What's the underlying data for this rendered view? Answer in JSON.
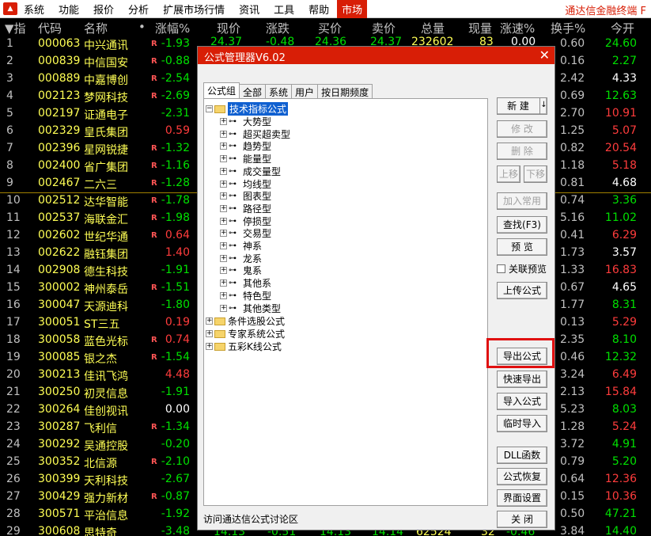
{
  "menubar": {
    "items": [
      "系统",
      "功能",
      "报价",
      "分析",
      "扩展市场行情",
      "资讯",
      "工具",
      "帮助"
    ],
    "active_tab": "市场",
    "right_title": "通达信金融终端 F"
  },
  "columns": {
    "idx": "▼指",
    "code": "代码",
    "name": "名称",
    "dot": "•",
    "chg_pct": "涨幅%",
    "price": "现价",
    "change": "涨跌",
    "bid": "买价",
    "ask": "卖价",
    "volume": "总量",
    "cur_vol": "现量",
    "speed": "涨速%",
    "turnover": "换手%",
    "open": "今开"
  },
  "rows": [
    {
      "idx": "1",
      "code": "000063",
      "name": "中兴通讯",
      "flag": "R",
      "chg": "-1.93",
      "turn": "0.60",
      "open": "24.60",
      "chg_c": "dn",
      "open_c": "dn"
    },
    {
      "idx": "2",
      "code": "000839",
      "name": "中信国安",
      "flag": "R",
      "chg": "-0.88",
      "turn": "0.16",
      "open": "2.27",
      "chg_c": "dn",
      "open_c": "dn"
    },
    {
      "idx": "3",
      "code": "000889",
      "name": "中嘉博创",
      "flag": "R",
      "chg": "-2.54",
      "turn": "2.42",
      "open": "4.33",
      "chg_c": "dn",
      "open_c": "flat"
    },
    {
      "idx": "4",
      "code": "002123",
      "name": "梦网科技",
      "flag": "R",
      "chg": "-2.69",
      "turn": "0.69",
      "open": "12.63",
      "chg_c": "dn",
      "open_c": "dn"
    },
    {
      "idx": "5",
      "code": "002197",
      "name": "证通电子",
      "flag": "",
      "chg": "-2.31",
      "turn": "2.70",
      "open": "10.91",
      "chg_c": "dn",
      "open_c": "up"
    },
    {
      "idx": "6",
      "code": "002329",
      "name": "皇氏集团",
      "flag": "",
      "chg": "0.59",
      "turn": "1.25",
      "open": "5.07",
      "chg_c": "up",
      "open_c": "up"
    },
    {
      "idx": "7",
      "code": "002396",
      "name": "星网锐捷",
      "flag": "R",
      "chg": "-1.32",
      "turn": "0.82",
      "open": "20.54",
      "chg_c": "dn",
      "open_c": "up"
    },
    {
      "idx": "8",
      "code": "002400",
      "name": "省广集团",
      "flag": "R",
      "chg": "-1.16",
      "turn": "1.18",
      "open": "5.18",
      "chg_c": "dn",
      "open_c": "up"
    },
    {
      "idx": "9",
      "code": "002467",
      "name": "二六三",
      "flag": "R",
      "chg": "-1.28",
      "turn": "0.81",
      "open": "4.68",
      "chg_c": "dn",
      "open_c": "flat"
    },
    {
      "idx": "10",
      "code": "002512",
      "name": "达华智能",
      "flag": "R",
      "chg": "-1.78",
      "turn": "0.74",
      "open": "3.36",
      "chg_c": "dn",
      "open_c": "dn"
    },
    {
      "idx": "11",
      "code": "002537",
      "name": "海联金汇",
      "flag": "R",
      "chg": "-1.98",
      "turn": "5.16",
      "open": "11.02",
      "chg_c": "dn",
      "open_c": "dn"
    },
    {
      "idx": "12",
      "code": "002602",
      "name": "世纪华通",
      "flag": "R",
      "chg": "0.64",
      "turn": "0.41",
      "open": "6.29",
      "chg_c": "up",
      "open_c": "up"
    },
    {
      "idx": "13",
      "code": "002622",
      "name": "融钰集团",
      "flag": "",
      "chg": "1.40",
      "turn": "1.73",
      "open": "3.57",
      "chg_c": "up",
      "open_c": "flat"
    },
    {
      "idx": "14",
      "code": "002908",
      "name": "德生科技",
      "flag": "",
      "chg": "-1.91",
      "turn": "1.33",
      "open": "16.83",
      "chg_c": "dn",
      "open_c": "up"
    },
    {
      "idx": "15",
      "code": "300002",
      "name": "神州泰岳",
      "flag": "R",
      "chg": "-1.51",
      "turn": "0.67",
      "open": "4.65",
      "chg_c": "dn",
      "open_c": "flat"
    },
    {
      "idx": "16",
      "code": "300047",
      "name": "天源迪科",
      "flag": "",
      "chg": "-1.80",
      "turn": "1.77",
      "open": "8.31",
      "chg_c": "dn",
      "open_c": "dn"
    },
    {
      "idx": "17",
      "code": "300051",
      "name": "ST三五",
      "flag": "",
      "chg": "0.19",
      "turn": "0.13",
      "open": "5.29",
      "chg_c": "up",
      "open_c": "up"
    },
    {
      "idx": "18",
      "code": "300058",
      "name": "蓝色光标",
      "flag": "R",
      "chg": "0.74",
      "turn": "2.35",
      "open": "8.10",
      "chg_c": "up",
      "open_c": "dn"
    },
    {
      "idx": "19",
      "code": "300085",
      "name": "银之杰",
      "flag": "R",
      "chg": "-1.54",
      "turn": "0.46",
      "open": "12.32",
      "chg_c": "dn",
      "open_c": "dn"
    },
    {
      "idx": "20",
      "code": "300213",
      "name": "佳讯飞鸿",
      "flag": "",
      "chg": "4.48",
      "turn": "3.24",
      "open": "6.49",
      "chg_c": "up",
      "open_c": "up"
    },
    {
      "idx": "21",
      "code": "300250",
      "name": "初灵信息",
      "flag": "",
      "chg": "-1.91",
      "turn": "2.13",
      "open": "15.84",
      "chg_c": "dn",
      "open_c": "up"
    },
    {
      "idx": "22",
      "code": "300264",
      "name": "佳创视讯",
      "flag": "",
      "chg": "0.00",
      "turn": "5.23",
      "open": "8.03",
      "chg_c": "flat",
      "open_c": "dn"
    },
    {
      "idx": "23",
      "code": "300287",
      "name": "飞利信",
      "flag": "R",
      "chg": "-1.34",
      "turn": "1.28",
      "open": "5.24",
      "chg_c": "dn",
      "open_c": "up"
    },
    {
      "idx": "24",
      "code": "300292",
      "name": "吴通控股",
      "flag": "",
      "chg": "-0.20",
      "turn": "3.72",
      "open": "4.91",
      "chg_c": "dn",
      "open_c": "dn"
    },
    {
      "idx": "25",
      "code": "300352",
      "name": "北信源",
      "flag": "R",
      "chg": "-2.10",
      "turn": "0.79",
      "open": "5.20",
      "chg_c": "dn",
      "open_c": "dn"
    },
    {
      "idx": "26",
      "code": "300399",
      "name": "天利科技",
      "flag": "",
      "chg": "-2.67",
      "turn": "0.64",
      "open": "12.36",
      "chg_c": "dn",
      "open_c": "up"
    },
    {
      "idx": "27",
      "code": "300429",
      "name": "强力新材",
      "flag": "R",
      "chg": "-0.87",
      "turn": "0.15",
      "open": "10.36",
      "chg_c": "dn",
      "open_c": "up"
    },
    {
      "idx": "28",
      "code": "300571",
      "name": "平治信息",
      "flag": "",
      "chg": "-1.92",
      "turn": "0.50",
      "open": "47.21",
      "chg_c": "dn",
      "open_c": "dn"
    },
    {
      "idx": "29",
      "code": "300608",
      "name": "思特奇",
      "flag": "",
      "chg": "-3.48",
      "turn": "3.84",
      "open": "14.40",
      "chg_c": "dn",
      "open_c": "dn"
    }
  ],
  "row1_partial": {
    "price": "24.37",
    "change": "-0.48",
    "bid": "24.36",
    "ask": "24.37",
    "volume": "232602",
    "cur_vol": "83",
    "speed": "0.00"
  },
  "row29_partial": {
    "price": "14.13",
    "change": "-0.51",
    "bid": "14.13",
    "ask": "14.14",
    "volume": "62524",
    "cur_vol": "32",
    "speed": "-0.46"
  },
  "dialog": {
    "title": "公式管理器V6.02",
    "close": "✕",
    "tabs": [
      "公式组",
      "全部",
      "系统",
      "用户",
      "按日期频度"
    ],
    "tree_root": "技术指标公式",
    "tree_children": [
      "大势型",
      "超买超卖型",
      "趋势型",
      "能量型",
      "成交量型",
      "均线型",
      "图表型",
      "路径型",
      "停损型",
      "交易型",
      "神系",
      "龙系",
      "鬼系",
      "其他系",
      "特色型",
      "其他类型"
    ],
    "tree_other_roots": [
      "条件选股公式",
      "专家系统公式",
      "五彩K线公式"
    ],
    "status": "访问通达信公式讨论区",
    "buttons": {
      "new": "新 建",
      "new_arrow": "↓",
      "edit": "修 改",
      "delete": "删 除",
      "up": "上移",
      "down": "下移",
      "add_common": "加入常用",
      "find": "查找(F3)",
      "preview": "预 览",
      "link_preview": "关联预览",
      "upload": "上传公式",
      "export": "导出公式",
      "quick_export": "快速导出",
      "import": "导入公式",
      "temp_import": "临时导入",
      "dll": "DLL函数",
      "restore": "公式恢复",
      "ui_settings": "界面设置",
      "close": "关 闭"
    }
  }
}
